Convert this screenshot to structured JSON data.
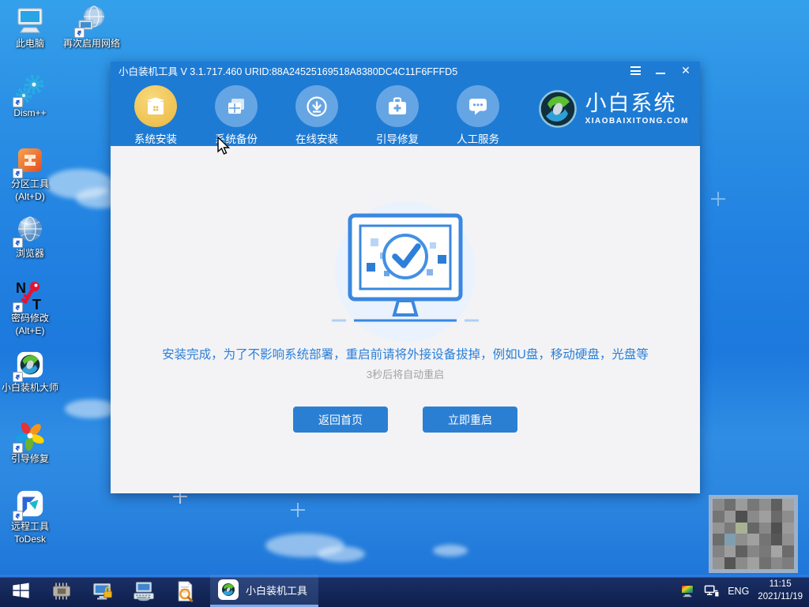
{
  "desktop": {
    "icons": [
      {
        "label": "此电脑"
      },
      {
        "label": "再次启用网络"
      },
      {
        "label": "Dism++"
      },
      {
        "label": "分区工具",
        "label2": "(Alt+D)"
      },
      {
        "label": "浏览器"
      },
      {
        "label": "密码修改",
        "label2": "(Alt+E)"
      },
      {
        "label": "小白装机大师"
      },
      {
        "label": "引导修复"
      },
      {
        "label": "远程工具",
        "label2": "ToDesk"
      }
    ]
  },
  "window": {
    "title": "小白装机工具 V 3.1.717.460 URID:88A24525169518A8380DC4C11F6FFFD5",
    "nav": [
      {
        "label": "系统安装",
        "icon": "install-box-icon",
        "active": true
      },
      {
        "label": "系统备份",
        "icon": "backup-windows-icon",
        "active": false
      },
      {
        "label": "在线安装",
        "icon": "download-icon",
        "active": false
      },
      {
        "label": "引导修复",
        "icon": "toolbox-icon",
        "active": false
      },
      {
        "label": "人工服务",
        "icon": "chat-bubble-icon",
        "active": false
      }
    ],
    "brand": {
      "name": "小白系统",
      "site": "XIAOBAIXITONG.COM"
    },
    "main": {
      "message": "安装完成，为了不影响系统部署，重启前请将外接设备拔掉，例如U盘，移动硬盘，光盘等",
      "countdown": "3秒后将自动重启",
      "back_button": "返回首页",
      "restart_button": "立即重启"
    }
  },
  "taskbar": {
    "active_app": "小白装机工具",
    "language": "ENG",
    "time": "11:15",
    "date": "2021/11/19"
  },
  "colors": {
    "titlebar_blue": "#1e7bd4",
    "nav_active_gold": "#eec04e",
    "accent_blue": "#2b7fd3",
    "message_blue": "#2b7fd8",
    "taskbar_navy": "#0e1f4c",
    "content_gray": "#f3f3f5"
  }
}
